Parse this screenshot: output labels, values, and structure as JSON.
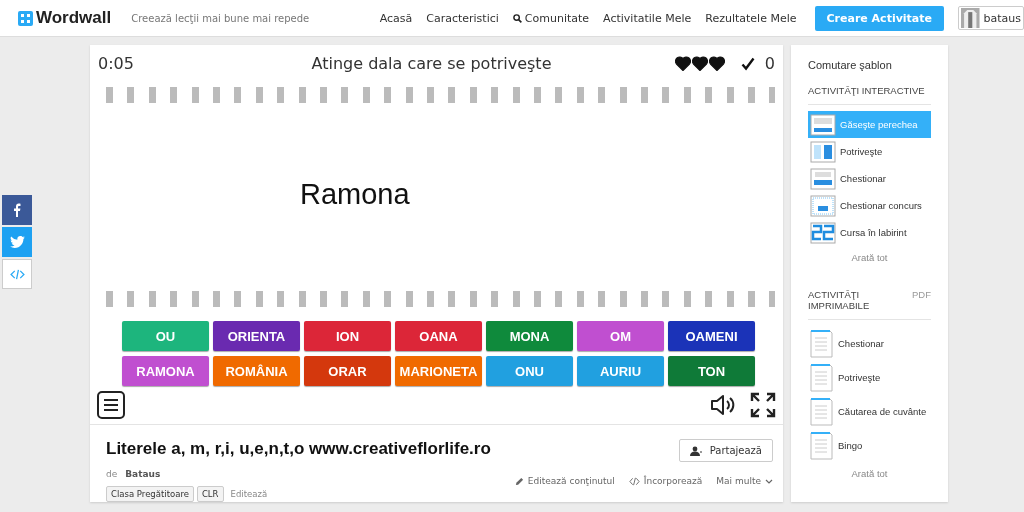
{
  "header": {
    "logo": "Wordwall",
    "tagline": "Creează lecţii mai bune mai repede",
    "nav": [
      {
        "label": "Acasă",
        "kind": "plain"
      },
      {
        "label": "Caracteristici",
        "kind": "plain"
      },
      {
        "label": "Comunitate",
        "kind": "search"
      },
      {
        "label": "Activitatile Mele",
        "kind": "plain"
      },
      {
        "label": "Rezultatele Mele",
        "kind": "plain"
      }
    ],
    "create_button": "Creare Activitate",
    "user": "bataus"
  },
  "social": [
    {
      "kind": "facebook"
    },
    {
      "kind": "twitter"
    },
    {
      "kind": "embed"
    }
  ],
  "game": {
    "timer": "0:05",
    "instruction": "Atinge dala care se potriveşte",
    "hearts": [
      {
        "filled": true
      },
      {
        "filled": true
      },
      {
        "filled": true
      }
    ],
    "score": "0",
    "prompt": "Ramona",
    "tiles": [
      {
        "label": "OU",
        "color": "#1db57d"
      },
      {
        "label": "ORIENTA",
        "color": "#6a2ab0"
      },
      {
        "label": "ION",
        "color": "#dc2638"
      },
      {
        "label": "OANA",
        "color": "#dc2638"
      },
      {
        "label": "MONA",
        "color": "#0f8a3c"
      },
      {
        "label": "OM",
        "color": "#c04fd0"
      },
      {
        "label": "OAMENI",
        "color": "#1b33b8"
      },
      {
        "label": "RAMONA",
        "color": "#c04fd0"
      },
      {
        "label": "ROMÂNIA",
        "color": "#f06a00"
      },
      {
        "label": "ORAR",
        "color": "#d4380d"
      },
      {
        "label": "MARIONETA",
        "color": "#f06a00"
      },
      {
        "label": "ONU",
        "color": "#21a0e0"
      },
      {
        "label": "AURIU",
        "color": "#21a0e0"
      },
      {
        "label": "TON",
        "color": "#0f7a38"
      }
    ]
  },
  "info": {
    "title": "Literele a, m, r,i, u,e,n,t,o www.creativeflorlife.ro",
    "by": "de",
    "author": "Bataus",
    "tags": [
      "Clasa Pregătitoare",
      "CLR"
    ],
    "edit_tags": "Editează",
    "share_button": "Partajează",
    "actions": [
      {
        "label": "Editează conţinutul",
        "kind": "edit"
      },
      {
        "label": "Încorporează",
        "kind": "embed"
      },
      {
        "label": "Mai multe",
        "kind": "more"
      }
    ]
  },
  "sidebar": {
    "title": "Comutare şablon",
    "interactive": {
      "heading": "ACTIVITĂŢI INTERACTIVE",
      "items": [
        {
          "label": "Găseşte perechea",
          "selected": true
        },
        {
          "label": "Potriveşte",
          "selected": false
        },
        {
          "label": "Chestionar",
          "selected": false
        },
        {
          "label": "Chestionar concurs",
          "selected": false
        },
        {
          "label": "Cursa în labirint",
          "selected": false
        }
      ],
      "show_all": "Arată tot"
    },
    "printable": {
      "heading": "ACTIVITĂŢI IMPRIMABILE",
      "badge": "PDF",
      "items": [
        {
          "label": "Chestionar"
        },
        {
          "label": "Potriveşte"
        },
        {
          "label": "Căutarea de cuvânte"
        },
        {
          "label": "Bingo"
        }
      ],
      "show_all": "Arată tot"
    }
  }
}
